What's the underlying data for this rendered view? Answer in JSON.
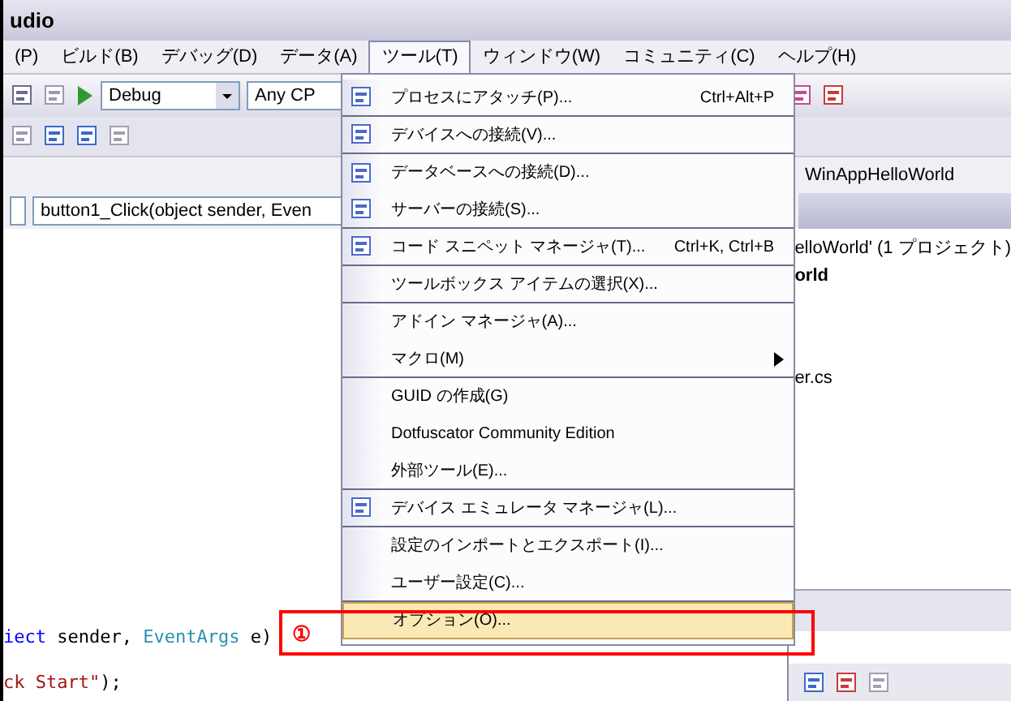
{
  "window": {
    "title": "udio"
  },
  "menu_bar": [
    {
      "label": "(P)",
      "selected": false
    },
    {
      "label": "ビルド(B)",
      "selected": false
    },
    {
      "label": "デバッグ(D)",
      "selected": false
    },
    {
      "label": "データ(A)",
      "selected": false
    },
    {
      "label": "ツール(T)",
      "selected": true
    },
    {
      "label": "ウィンドウ(W)",
      "selected": false
    },
    {
      "label": "コミュニティ(C)",
      "selected": false
    },
    {
      "label": "ヘルプ(H)",
      "selected": false
    }
  ],
  "toolbar": {
    "configuration": "Debug",
    "platform": "Any CP"
  },
  "code_nav": {
    "member": "button1_Click(object sender, Even"
  },
  "solution_explorer": {
    "header": "WinAppHelloWorld",
    "lines": [
      {
        "text": "elloWorld' (1 プロジェクト)",
        "bold": false
      },
      {
        "text": "orld",
        "bold": true
      },
      {
        "text": "er.cs",
        "bold": false
      }
    ]
  },
  "editor": {
    "lines": [
      [
        {
          "text": "iect",
          "kind": "keyword"
        },
        {
          "text": " sender, ",
          "kind": "plain"
        },
        {
          "text": "EventArgs",
          "kind": "type"
        },
        {
          "text": " e)",
          "kind": "plain"
        }
      ],
      [
        {
          "text": "ck Start\"",
          "kind": "string"
        },
        {
          "text": ");",
          "kind": "plain"
        }
      ]
    ]
  },
  "tools_menu": {
    "items": [
      {
        "label": "プロセスにアタッチ(P)...",
        "shortcut": "Ctrl+Alt+P",
        "has_icon": true,
        "submenu": false,
        "separator_after": true,
        "selected": false
      },
      {
        "label": "デバイスへの接続(V)...",
        "has_icon": true,
        "submenu": false,
        "separator_after": true,
        "selected": false
      },
      {
        "label": "データベースへの接続(D)...",
        "has_icon": true,
        "submenu": false,
        "separator_after": false,
        "selected": false
      },
      {
        "label": "サーバーの接続(S)...",
        "has_icon": true,
        "submenu": false,
        "separator_after": true,
        "selected": false
      },
      {
        "label": "コード スニペット マネージャ(T)...",
        "shortcut": "Ctrl+K, Ctrl+B",
        "has_icon": true,
        "submenu": false,
        "separator_after": true,
        "selected": false
      },
      {
        "label": "ツールボックス アイテムの選択(X)...",
        "has_icon": false,
        "submenu": false,
        "separator_after": true,
        "selected": false
      },
      {
        "label": "アドイン マネージャ(A)...",
        "has_icon": false,
        "submenu": false,
        "separator_after": false,
        "selected": false
      },
      {
        "label": "マクロ(M)",
        "has_icon": false,
        "submenu": true,
        "separator_after": true,
        "selected": false
      },
      {
        "label": "GUID の作成(G)",
        "has_icon": false,
        "submenu": false,
        "separator_after": false,
        "selected": false
      },
      {
        "label": "Dotfuscator Community Edition",
        "has_icon": false,
        "submenu": false,
        "separator_after": false,
        "selected": false
      },
      {
        "label": "外部ツール(E)...",
        "has_icon": false,
        "submenu": false,
        "separator_after": true,
        "selected": false
      },
      {
        "label": "デバイス エミュレータ マネージャ(L)...",
        "has_icon": true,
        "submenu": false,
        "separator_after": true,
        "selected": false
      },
      {
        "label": "設定のインポートとエクスポート(I)...",
        "has_icon": false,
        "submenu": false,
        "separator_after": false,
        "selected": false
      },
      {
        "label": "ユーザー設定(C)...",
        "has_icon": false,
        "submenu": false,
        "separator_after": true,
        "selected": false
      },
      {
        "label": "オプション(O)...",
        "has_icon": false,
        "submenu": false,
        "separator_after": false,
        "selected": true
      }
    ]
  },
  "annotation": {
    "label": "①"
  }
}
